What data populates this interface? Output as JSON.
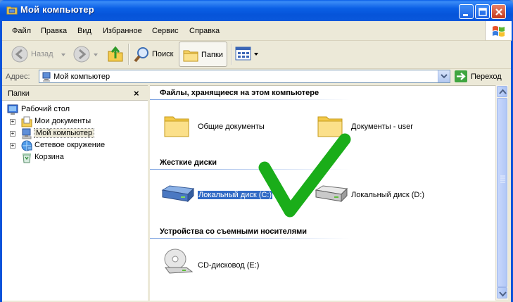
{
  "window": {
    "title": "Мой компьютер"
  },
  "menu": [
    "Файл",
    "Правка",
    "Вид",
    "Избранное",
    "Сервис",
    "Справка"
  ],
  "toolbar": {
    "back_label": "Назад",
    "search_label": "Поиск",
    "folders_label": "Папки"
  },
  "address": {
    "label": "Адрес:",
    "value": "Мой компьютер",
    "go_label": "Переход"
  },
  "folders_pane": {
    "title": "Папки",
    "tree": [
      {
        "label": "Рабочий стол",
        "icon": "desktop-icon"
      },
      {
        "label": "Мои документы",
        "icon": "my-documents-icon"
      },
      {
        "label": "Мой компьютер",
        "icon": "my-computer-icon",
        "selected": true
      },
      {
        "label": "Сетевое окружение",
        "icon": "network-icon"
      },
      {
        "label": "Корзина",
        "icon": "recycle-bin-icon"
      }
    ]
  },
  "content": {
    "groups": [
      {
        "title": "Файлы, хранящиеся на этом компьютере",
        "items": [
          {
            "label": "Общие документы",
            "icon": "folder-icon"
          },
          {
            "label": "Документы - user",
            "icon": "folder-icon"
          }
        ]
      },
      {
        "title": "Жесткие диски",
        "items": [
          {
            "label": "Локальный диск (C:)",
            "icon": "hard-drive-icon",
            "selected": true
          },
          {
            "label": "Локальный диск (D:)",
            "icon": "hard-drive-icon"
          }
        ]
      },
      {
        "title": "Устройства со съемными носителями",
        "items": [
          {
            "label": "CD-дисковод (E:)",
            "icon": "cd-drive-icon"
          }
        ]
      }
    ]
  },
  "colors": {
    "titlebar": "#0a5ee8",
    "selection": "#316ac5",
    "checkmark": "#1aad19"
  }
}
